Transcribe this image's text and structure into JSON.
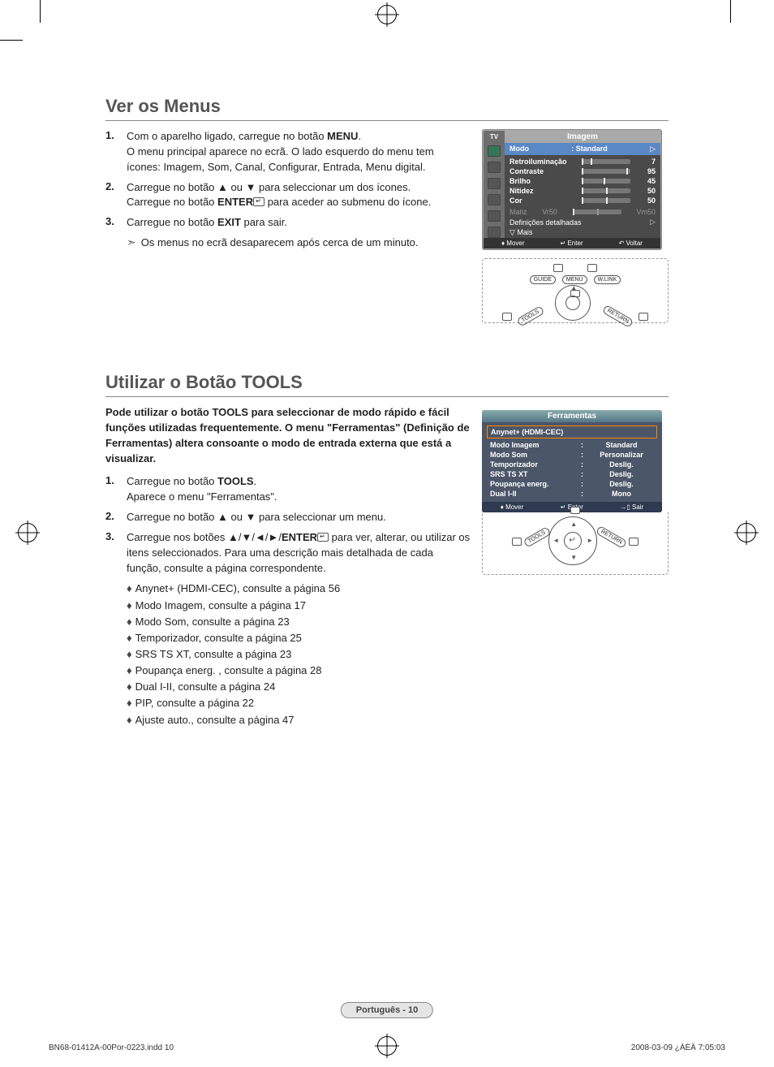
{
  "section1": {
    "title": "Ver os Menus",
    "steps": [
      {
        "n": "1.",
        "lines": [
          {
            "pre": "Com o aparelho ligado, carregue no botão ",
            "bold": "MENU",
            "post": "."
          },
          {
            "plain": "O menu principal aparece no ecrã. O lado esquerdo do menu tem ícones: Imagem, Som, Canal, Configurar, Entrada, Menu digital."
          }
        ]
      },
      {
        "n": "2.",
        "lines": [
          {
            "plain": "Carregue no botão ▲ ou ▼ para seleccionar um dos ícones."
          },
          {
            "pre": "Carregue no botão ",
            "bold": "ENTER",
            "enter_ic": true,
            "post": " para aceder ao submenu do ícone."
          }
        ]
      },
      {
        "n": "3.",
        "lines": [
          {
            "pre": "Carregue no botão ",
            "bold": "EXIT",
            "post": " para sair."
          }
        ]
      }
    ],
    "note": "Os menus no ecrã desaparecem após cerca de um minuto."
  },
  "osd1": {
    "tv_label": "TV",
    "title": "Imagem",
    "mode_label": "Modo",
    "mode_value": ": Standard",
    "items": [
      {
        "label": "Retroiluminação",
        "val": "7",
        "pos": "18%"
      },
      {
        "label": "Contraste",
        "val": "95",
        "pos": "92%"
      },
      {
        "label": "Brilho",
        "val": "45",
        "pos": "45%"
      },
      {
        "label": "Nitidez",
        "val": "50",
        "pos": "50%"
      },
      {
        "label": "Cor",
        "val": "50",
        "pos": "50%"
      }
    ],
    "matiz": {
      "label": "Matiz",
      "left": "Vr50",
      "right": "Vm50"
    },
    "detail": "Definições detalhadas",
    "more": "▽ Mais",
    "foot_move": "Mover",
    "foot_enter": "Enter",
    "foot_back": "Voltar"
  },
  "remote1": {
    "guide": "GUIDE",
    "menu": "MENU",
    "wlink": "W.LINK",
    "tools": "TOOLS",
    "return": "RETURN"
  },
  "section2": {
    "title": "Utilizar o Botão TOOLS",
    "intro": "Pode utilizar o botão TOOLS para seleccionar de modo rápido e fácil funções utilizadas frequentemente. O menu \"Ferramentas\" (Definição de Ferramentas) altera consoante o modo de entrada externa que está a visualizar.",
    "steps": [
      {
        "n": "1.",
        "lines": [
          {
            "pre": "Carregue no botão ",
            "bold": "TOOLS",
            "post": "."
          },
          {
            "plain": "Aparece o menu \"Ferramentas\"."
          }
        ]
      },
      {
        "n": "2.",
        "lines": [
          {
            "plain": "Carregue no botão ▲ ou ▼ para seleccionar um menu."
          }
        ]
      },
      {
        "n": "3.",
        "lines": [
          {
            "pre": "Carregue nos botões ▲/▼/◄/►/",
            "bold": "ENTER",
            "enter_ic": true,
            "post": " para ver, alterar, ou utilizar os itens seleccionados. Para uma descrição mais detalhada de cada função, consulte a página correspondente."
          }
        ]
      }
    ],
    "bullets": [
      "Anynet+ (HDMI-CEC), consulte a página 56",
      "Modo Imagem, consulte a página 17",
      "Modo Som, consulte a página 23",
      "Temporizador, consulte a página 25",
      "SRS TS XT, consulte a página 23",
      "Poupança energ. , consulte a página 28",
      "Dual I-II, consulte a página 24",
      "PIP, consulte a página 22",
      "Ajuste auto., consulte a página 47"
    ]
  },
  "osd2": {
    "title": "Ferramentas",
    "highlight": "Anynet+ (HDMI-CEC)",
    "rows": [
      {
        "l": "Modo Imagem",
        "v": "Standard"
      },
      {
        "l": "Modo Som",
        "v": "Personalizar"
      },
      {
        "l": "Temporizador",
        "v": "Deslig."
      },
      {
        "l": "SRS TS XT",
        "v": "Deslig."
      },
      {
        "l": "Poupança energ.",
        "v": "Deslig."
      },
      {
        "l": "Dual I-II",
        "v": "Mono"
      }
    ],
    "foot_move": "Mover",
    "foot_enter": "Enter",
    "foot_exit": "Sair"
  },
  "remote2": {
    "tools": "TOOLS",
    "return": "RETURN"
  },
  "page_badge": "Português - 10",
  "footer_left": "BN68-01412A-00Por-0223.indd   10",
  "footer_right": "2008-03-09   ¿ÀÈÄ 7:05:03"
}
